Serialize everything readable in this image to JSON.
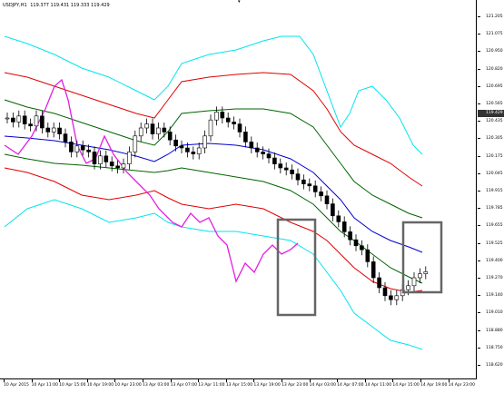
{
  "header": {
    "symbol_timeframe": "USDJPY,H1",
    "ohlc": "119.377 119.431 119.333 119.429"
  },
  "price_axis": {
    "ticks": [
      "121.205",
      "121.075",
      "120.950",
      "120.820",
      "120.695",
      "120.565",
      "120.435",
      "120.305",
      "120.175",
      "120.045",
      "119.915",
      "119.785",
      "119.655",
      "119.525",
      "119.400",
      "119.270",
      "119.140",
      "119.010",
      "118.880",
      "118.750",
      "118.620"
    ],
    "current_price": "119.429",
    "current_price_fraction": 0.3
  },
  "time_axis": {
    "ticks": [
      "10 Apr 2015",
      "10 Apr 11:00",
      "10 Apr 15:00",
      "10 Apr 19:00",
      "10 Apr 23:00",
      "13 Apr 03:00",
      "13 Apr 07:00",
      "13 Apr 11:00",
      "13 Apr 15:00",
      "13 Apr 19:00",
      "13 Apr 23:00",
      "14 Apr 03:00",
      "14 Apr 07:00",
      "14 Apr 11:00",
      "14 Apr 15:00",
      "14 Apr 19:00",
      "14 Apr 23:00"
    ]
  },
  "colors": {
    "cyan": "#00e5ee",
    "red": "#e00000",
    "green": "#006400",
    "blue": "#0000d0",
    "magenta": "#e21ee2",
    "candle": "#000000",
    "box": "#666666"
  },
  "icons": {
    "menu_arrow": "triangle-down-icon"
  }
}
